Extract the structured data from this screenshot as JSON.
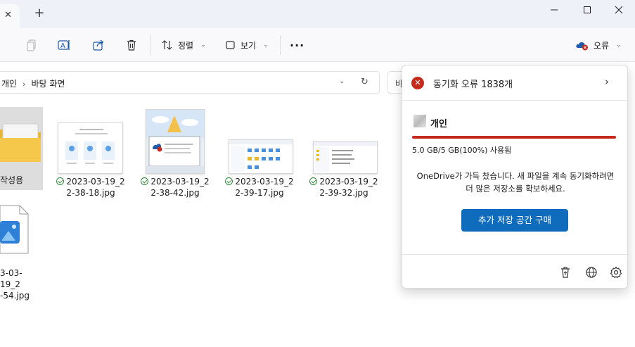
{
  "titlebar": {
    "tab_close": "✕",
    "new_tab": "+",
    "minimize_icon": "minimize-icon",
    "maximize_icon": "maximize-icon",
    "close_icon": "close-icon"
  },
  "toolbar": {
    "sort_label": "정렬",
    "view_label": "보기",
    "more_label": "···",
    "status_label": "오류",
    "icons": [
      "copy-icon",
      "rename-icon",
      "share-icon",
      "delete-icon",
      "sort-icon",
      "view-icon"
    ]
  },
  "address": {
    "crumbs": [
      "개인",
      "바탕 화면"
    ],
    "separator": "›",
    "search_text": "바"
  },
  "files": [
    {
      "name_line1": "작성용",
      "name_line2": "",
      "synced": false
    },
    {
      "name_line1": "2023-03-19_2",
      "name_line2": "2-38-18.jpg",
      "synced": true
    },
    {
      "name_line1": "2023-03-19_2",
      "name_line2": "2-38-42.jpg",
      "synced": true
    },
    {
      "name_line1": "2023-03-19_2",
      "name_line2": "2-39-17.jpg",
      "synced": true
    },
    {
      "name_line1": "2023-03-19_2",
      "name_line2": "2-39-32.jpg",
      "synced": true
    },
    {
      "name_line1": "3-03-19_2",
      "name_line2": "-54.jpg",
      "synced": false
    }
  ],
  "onedrive_panel": {
    "header_title": "동기화 오류 1838개",
    "error_glyph": "✕",
    "account_name": "개인",
    "usage_text": "5.0 GB/5 GB(100%) 사용됨",
    "usage_fraction": 1.0,
    "full_message": "OneDrive가 가득 찼습니다. 새 파일을 계속 동기화하려면 더 많은 저장소를 확보하세요.",
    "buy_button": "추가 저장 공간 구매",
    "footer_icons": [
      "recycle-bin-icon",
      "globe-icon",
      "settings-icon"
    ]
  },
  "colors": {
    "accent": "#0f6cbd",
    "error": "#c42b1c",
    "sync_ok": "#2e8b3e"
  }
}
